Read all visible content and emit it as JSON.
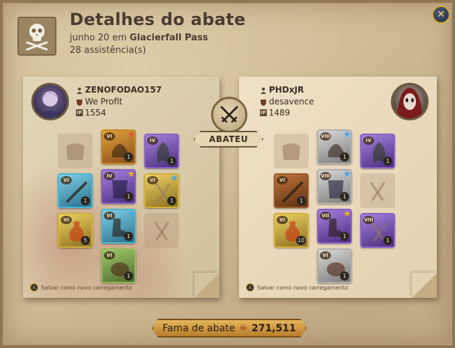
{
  "header": {
    "title": "Detalhes do abate",
    "date": "junho 20",
    "location_prefix": "em",
    "location": "Glacierfall Pass",
    "assists": "28 assistência(s)",
    "icon": "skull-crossbones-icon"
  },
  "close": {
    "icon": "close-icon",
    "glyph": "✕"
  },
  "center": {
    "icon": "crossed-swords-icon",
    "label": "ABATEU"
  },
  "killer": {
    "name": "ZENOFODAO157",
    "guild": "We Profit",
    "ip": "1554",
    "footnote": "Salvar como novo carregamento",
    "items": [
      {
        "slot": "bag",
        "tier": "",
        "quality": "empty",
        "qty": ""
      },
      {
        "slot": "head",
        "tier": "VI",
        "quality": "orange",
        "qty": "1",
        "star": "red"
      },
      {
        "slot": "cape",
        "tier": "IV",
        "quality": "purple",
        "qty": "1"
      },
      {
        "slot": "weapon",
        "tier": "VI",
        "quality": "cyan",
        "qty": "1"
      },
      {
        "slot": "chest",
        "tier": "IV",
        "quality": "purple",
        "qty": "1",
        "star": "gold"
      },
      {
        "slot": "offhand",
        "tier": "VI",
        "quality": "yellow",
        "qty": "1",
        "star": "blue"
      },
      {
        "slot": "potion",
        "tier": "VI",
        "quality": "yellow",
        "qty": "5"
      },
      {
        "slot": "shoes",
        "tier": "VI",
        "quality": "cyan",
        "qty": "1",
        "star": "blue"
      },
      {
        "slot": "food",
        "tier": "",
        "quality": "empty",
        "qty": ""
      },
      {
        "slot": "mount",
        "tier": "VI",
        "quality": "green",
        "qty": "1"
      }
    ]
  },
  "victim": {
    "name": "PHDxJR",
    "guild": "desavence",
    "ip": "1489",
    "footnote": "Salvar como novo carregamento",
    "items": [
      {
        "slot": "bag",
        "tier": "",
        "quality": "empty",
        "qty": ""
      },
      {
        "slot": "head",
        "tier": "VIII",
        "quality": "white",
        "qty": "1",
        "star": "blue"
      },
      {
        "slot": "cape",
        "tier": "IV",
        "quality": "purple",
        "qty": "1"
      },
      {
        "slot": "weapon",
        "tier": "VI",
        "quality": "dark",
        "qty": "1"
      },
      {
        "slot": "chest",
        "tier": "VIII",
        "quality": "white",
        "qty": "1",
        "star": "blue"
      },
      {
        "slot": "offhand",
        "tier": "",
        "quality": "empty",
        "qty": ""
      },
      {
        "slot": "potion",
        "tier": "VI",
        "quality": "yellow",
        "qty": "10"
      },
      {
        "slot": "shoes",
        "tier": "VII",
        "quality": "purple",
        "qty": "1",
        "star": "gold"
      },
      {
        "slot": "food",
        "tier": "VIII",
        "quality": "purple",
        "qty": "1"
      },
      {
        "slot": "mount",
        "tier": "VI",
        "quality": "white",
        "qty": "1"
      }
    ]
  },
  "fame": {
    "label": "Fama de abate",
    "icon": "skull-icon",
    "value": "271,511"
  },
  "colors": {
    "orange": "#c8891f",
    "green": "#8fbf56",
    "purple": "#8a5fc8",
    "cyan": "#49b7d0",
    "yellow": "#d4b13a",
    "white": "#b0b0b0",
    "dark": "#9a5a2a"
  }
}
